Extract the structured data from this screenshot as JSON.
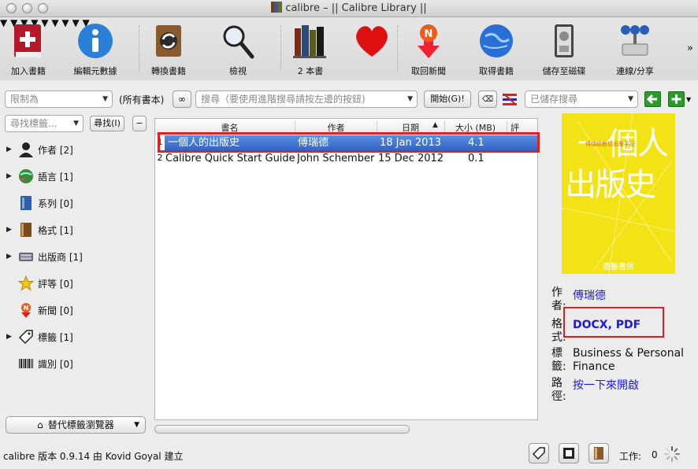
{
  "window": {
    "title": "calibre – || Calibre Library ||"
  },
  "toolbar": {
    "add": "加入書籍",
    "edit": "編輯元數據",
    "convert": "轉換書籍",
    "view": "檢視",
    "library": "2 本書",
    "news": "取回新聞",
    "get": "取得書籍",
    "save": "儲存至磁碟",
    "connect": "連線/分享",
    "more": "»"
  },
  "search": {
    "restrict": "限制為",
    "all_books": "(所有書本)",
    "placeholder": "搜尋（要使用進階搜尋請按左邊的按鈕)",
    "go": "開始(G)!",
    "saved_placeholder": "已儲存搜尋",
    "find_tag_placeholder": "尋找標籤...",
    "find_button": "尋找(I)",
    "minus": "−"
  },
  "tags": [
    {
      "label": "作者 [2]",
      "icon": "person-icon",
      "expand": true
    },
    {
      "label": "語言 [1]",
      "icon": "globe-icon",
      "expand": true
    },
    {
      "label": "系列 [0]",
      "icon": "book-series-icon",
      "expand": false
    },
    {
      "label": "格式 [1]",
      "icon": "format-book-icon",
      "expand": true
    },
    {
      "label": "出版商 [1]",
      "icon": "publisher-icon",
      "expand": true
    },
    {
      "label": "評等 [0]",
      "icon": "star-icon",
      "expand": false
    },
    {
      "label": "新聞 [0]",
      "icon": "news-icon",
      "expand": false
    },
    {
      "label": "標籤 [1]",
      "icon": "tag-icon",
      "expand": true
    },
    {
      "label": "識別 [0]",
      "icon": "barcode-icon",
      "expand": false
    }
  ],
  "tag_browser_button": "替代標籤瀏覽器",
  "columns": [
    "書名",
    "作者",
    "日期",
    "大小 (MB)",
    "評"
  ],
  "books": [
    {
      "num": "1",
      "title": "一個人的出版史",
      "author": "傅瑞德",
      "date": "18 Jan 2013",
      "size": "4.1"
    },
    {
      "num": "2",
      "title": "Calibre Quick Start Guide",
      "author": "John Schember",
      "date": "15 Dec 2012",
      "size": "0.1"
    }
  ],
  "cover": {
    "line1": "一個人",
    "line2": "出版史",
    "subtitle": "傅瑞德數位出版手記",
    "publisher": "遊藝書房"
  },
  "details": {
    "author_key": "作者:",
    "author": "傅瑞德",
    "format_key": "格式:",
    "formats": "DOCX, PDF",
    "tags_key": "標籤:",
    "tags_line1": "Business & Personal",
    "tags_line2": "Finance",
    "path_key": "路徑:",
    "path": "按一下來開啟"
  },
  "status": {
    "left": "calibre 版本 0.9.14 由 Kovid Goyal 建立",
    "jobs_label": "工作:",
    "jobs": "0"
  },
  "colors": {
    "selection": "#3a6fd1",
    "highlight": "#e02020",
    "cover": "#f3e316",
    "link": "#1a1adf"
  }
}
